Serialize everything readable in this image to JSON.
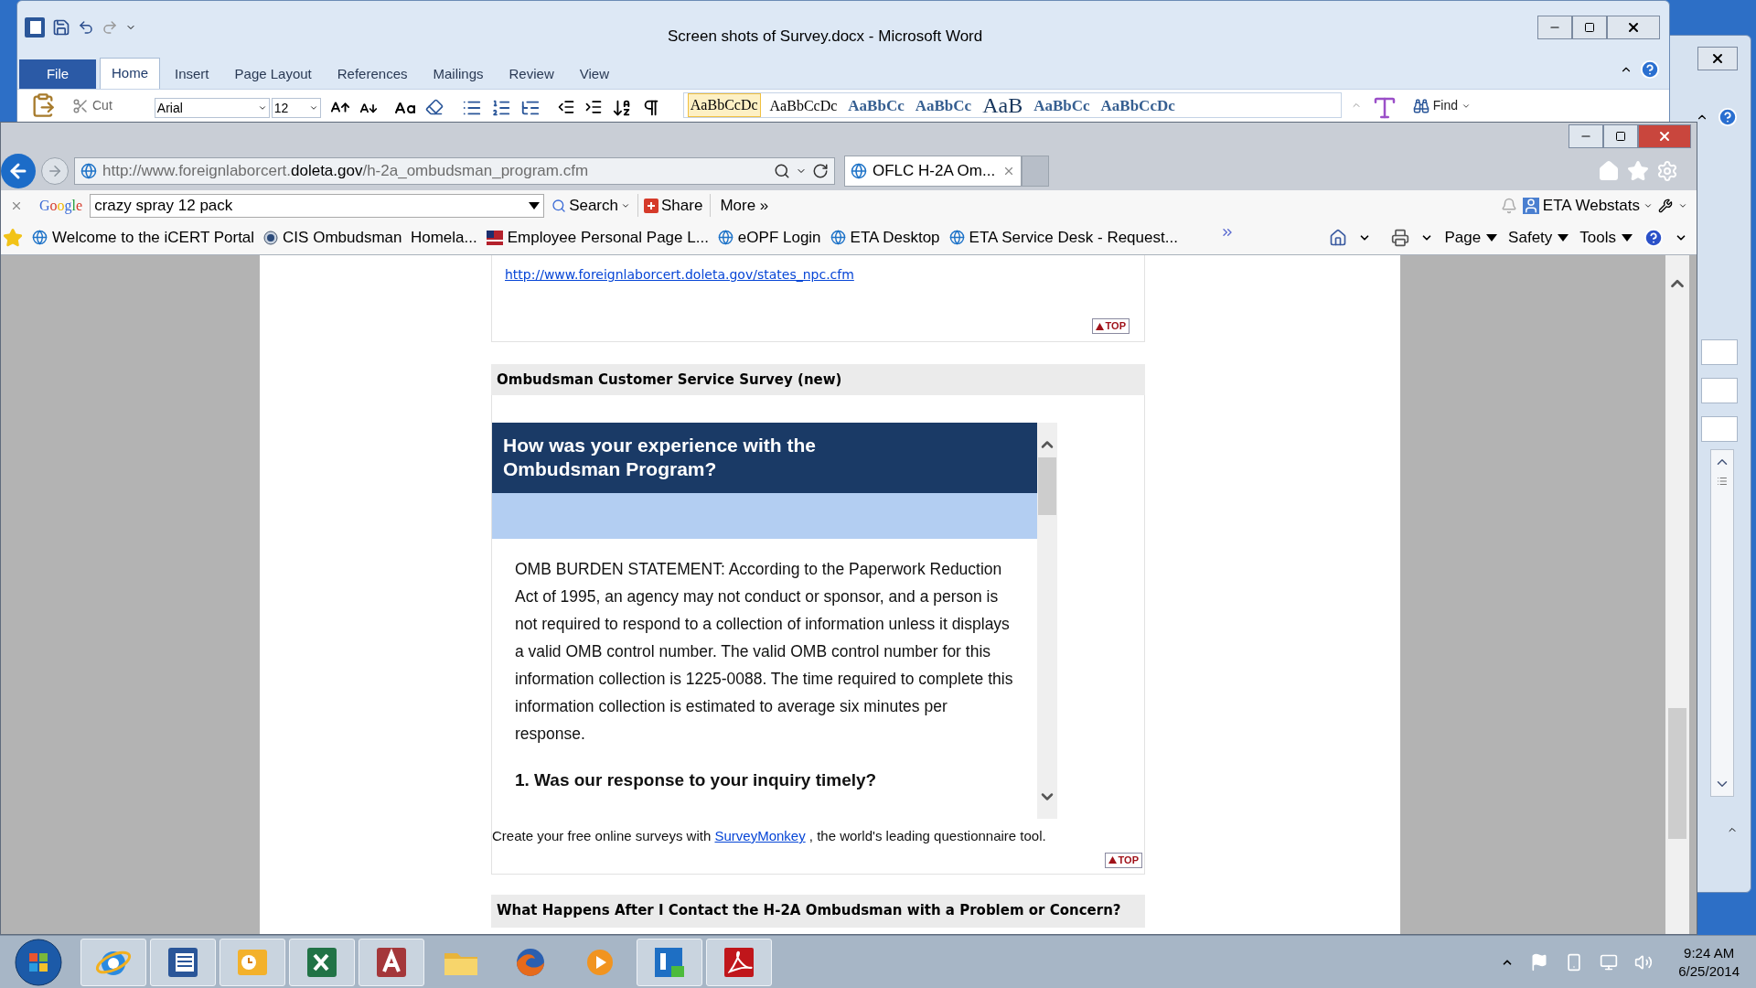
{
  "word_window": {
    "title": "Screen shots of Survey.docx - Microsoft Word",
    "tabs": [
      {
        "label": "File",
        "kind": "file",
        "selected": false
      },
      {
        "label": "Home",
        "kind": "tab",
        "selected": true
      },
      {
        "label": "Insert",
        "kind": "tab",
        "selected": false
      },
      {
        "label": "Page Layout",
        "kind": "tab",
        "selected": false
      },
      {
        "label": "References",
        "kind": "tab",
        "selected": false
      },
      {
        "label": "Mailings",
        "kind": "tab",
        "selected": false
      },
      {
        "label": "Review",
        "kind": "tab",
        "selected": false
      },
      {
        "label": "View",
        "kind": "tab",
        "selected": false
      }
    ],
    "ribbon": {
      "cut": "Cut",
      "font": "Arial",
      "size": "12",
      "styles": [
        "AaBbCcDc",
        "AaBbCcDc",
        "AaBbCc",
        "AaBbCc",
        "AaB",
        "AaBbCc",
        "AaBbCcDc"
      ],
      "find": "Find"
    }
  },
  "ie_window": {
    "address": {
      "before": "http://www.foreignlaborcert.",
      "domain": "doleta.gov",
      "after": "/h-2a_ombudsman_program.cfm"
    },
    "tab": {
      "title": "OFLC H-2A Om..."
    },
    "google_toolbar": {
      "logo": "Google",
      "query": "crazy spray 12 pack",
      "search": "Search",
      "share": "Share",
      "more": "More »",
      "webstats": "ETA Webstats"
    },
    "favorites": [
      {
        "label": "Welcome to the iCERT Portal",
        "kind": "page"
      },
      {
        "label": "CIS Ombudsman  Homela...",
        "kind": "seal"
      },
      {
        "label": "Employee Personal Page L...",
        "kind": "flag"
      },
      {
        "label": "eOPF Login",
        "kind": "page"
      },
      {
        "label": "ETA Desktop",
        "kind": "page"
      },
      {
        "label": "ETA Service Desk - Request...",
        "kind": "page"
      }
    ],
    "command_bar": [
      "Page",
      "Safety",
      "Tools"
    ]
  },
  "page": {
    "link": "http://www.foreignlaborcert.doleta.gov/states_npc.cfm",
    "top_button": "TOP",
    "survey_section": {
      "heading": "Ombudsman Customer Service Survey (new)",
      "survey_title": "How was your experience with the Ombudsman Program?",
      "statement": "OMB BURDEN STATEMENT: According to the Paperwork Reduction Act of 1995, an agency may not conduct or sponsor, and a person is not required to respond to a collection of information unless it displays a valid OMB control number. The valid OMB control number for this information collection is 1225-0088. The time required to complete this information collection is estimated to average six minutes per response.",
      "question": "1. Was our response to your inquiry timely?",
      "footer_before": "Create your free online surveys with",
      "footer_link": "SurveyMonkey",
      "footer_after": ", the world's leading questionnaire tool.",
      "top_button": "TOP"
    },
    "next_heading": "What Happens After I Contact the H-2A Ombudsman with a Problem or Concern?"
  },
  "taskbar": {
    "apps": [
      {
        "kind": "ie",
        "running": true
      },
      {
        "kind": "word",
        "running": true
      },
      {
        "kind": "outlook",
        "running": true
      },
      {
        "kind": "excel",
        "running": true
      },
      {
        "kind": "access",
        "running": true
      },
      {
        "kind": "explorer",
        "running": false
      },
      {
        "kind": "firefox",
        "running": false
      },
      {
        "kind": "media",
        "running": false
      },
      {
        "kind": "lync",
        "running": true
      },
      {
        "kind": "acrobat",
        "running": true
      }
    ],
    "time": "9:24 AM",
    "date": "6/25/2014"
  }
}
